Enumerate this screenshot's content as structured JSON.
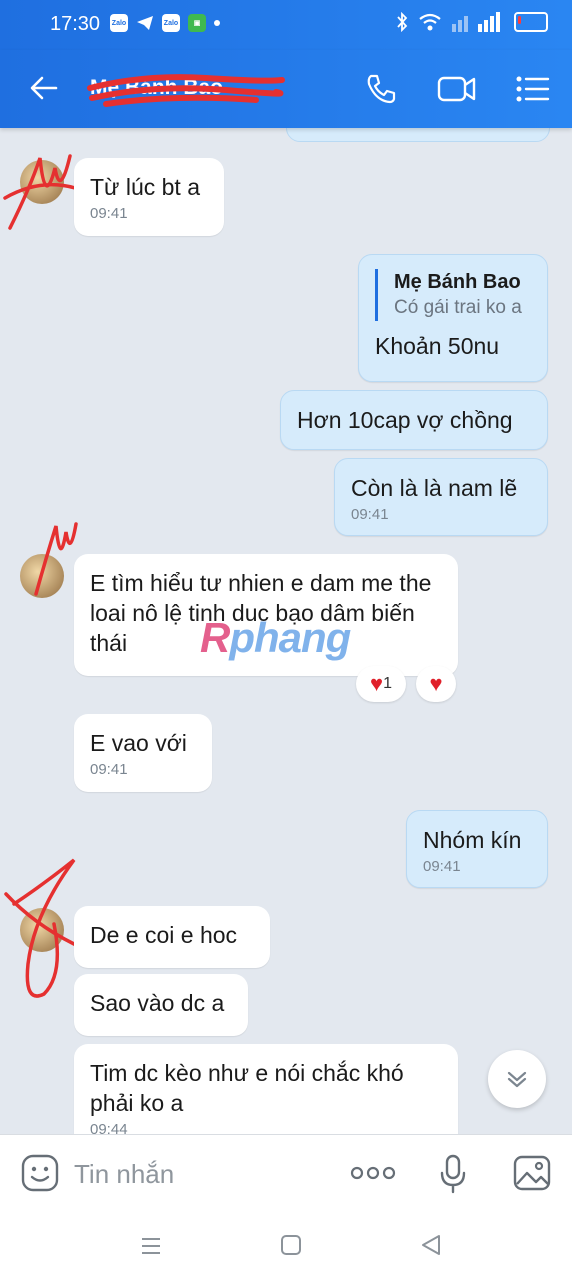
{
  "status_bar": {
    "time": "17:30",
    "battery_level": 0.15
  },
  "header": {
    "contact_name": "Mẹ Bánh Bao",
    "back_icon": "arrow-left-icon",
    "call_icon": "phone-icon",
    "video_icon": "video-camera-icon",
    "menu_icon": "list-menu-icon"
  },
  "messages": [
    {
      "from": "them",
      "text": "Từ lúc bt a",
      "time": "09:41"
    },
    {
      "from": "me",
      "quote_name": "Mẹ Bánh Bao",
      "quote_text": "Có gái trai ko a",
      "text": "Khoản 50nu"
    },
    {
      "from": "me",
      "text": "Hơn 10cap vợ chồng"
    },
    {
      "from": "me",
      "text": "Còn là là nam lẽ",
      "time": "09:41"
    },
    {
      "from": "them",
      "text": "E tìm hiểu tư nhien e dam me the loai nô lệ tinh duc bạo dâm biến thái",
      "reaction_count": "1"
    },
    {
      "from": "them",
      "text": "E vao  với",
      "time": "09:41"
    },
    {
      "from": "me",
      "text": "Nhóm kín",
      "time": "09:41"
    },
    {
      "from": "them",
      "text": "De e coi e hoc"
    },
    {
      "from": "them",
      "text": "Sao vào dc a"
    },
    {
      "from": "them",
      "text": "Tim dc kèo như e nói chắc khó phải ko a",
      "time": "09:44"
    }
  ],
  "watermark": {
    "part1": "R",
    "part2": "phang"
  },
  "input": {
    "placeholder": "Tin nhắn"
  }
}
